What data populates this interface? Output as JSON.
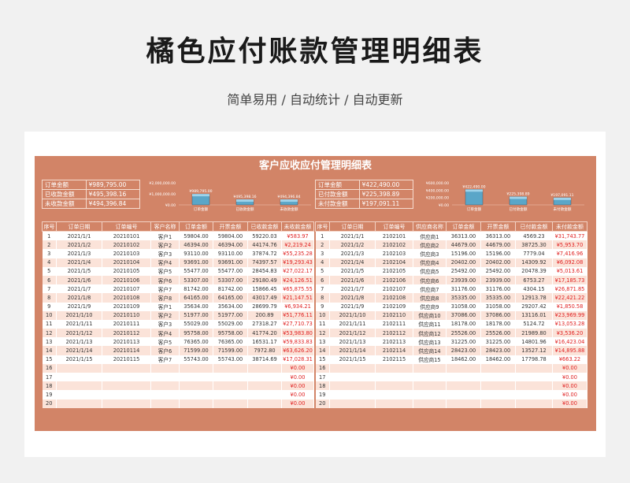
{
  "header": {
    "title": "橘色应付账款管理明细表",
    "subtitle": "简单易用 / 自动统计 / 自动更新"
  },
  "sheet": {
    "title": "客户应收应付管理明细表"
  },
  "receivable": {
    "summary": [
      {
        "label": "订单金额",
        "value": "¥989,795.00"
      },
      {
        "label": "已收款金额",
        "value": "¥495,398.16"
      },
      {
        "label": "未收款金额",
        "value": "¥494,396.84"
      }
    ],
    "chart": {
      "type": "bar",
      "categories": [
        "订单金额",
        "已收款金额",
        "未收款金额"
      ],
      "values": [
        989795.0,
        495398.16,
        494396.84
      ],
      "value_labels": [
        "¥989,795.00",
        "¥495,398.16",
        "¥494,396.84"
      ],
      "yticks": [
        "¥2,000,000.00",
        "¥1,000,000.00",
        "¥0.00"
      ],
      "ylim": [
        0,
        2000000
      ],
      "bar_color": "#5aa6c8"
    },
    "columns": [
      "序号",
      "订单日期",
      "订单编号",
      "客户名称",
      "订单金额",
      "开票金额",
      "已收款金额",
      "未收款金额"
    ],
    "rows": [
      [
        "1",
        "2021/1/1",
        "20210101",
        "客户1",
        "59804.00",
        "59804.00",
        "59220.03",
        "¥583.97"
      ],
      [
        "2",
        "2021/1/2",
        "20210102",
        "客户2",
        "46394.00",
        "46394.00",
        "44174.76",
        "¥2,219.24"
      ],
      [
        "3",
        "2021/1/3",
        "20210103",
        "客户3",
        "93110.00",
        "93110.00",
        "37874.72",
        "¥55,235.28"
      ],
      [
        "4",
        "2021/1/4",
        "20210104",
        "客户4",
        "93691.00",
        "93691.00",
        "74397.57",
        "¥19,293.43"
      ],
      [
        "5",
        "2021/1/5",
        "20210105",
        "客户5",
        "55477.00",
        "55477.00",
        "28454.83",
        "¥27,022.17"
      ],
      [
        "6",
        "2021/1/6",
        "20210106",
        "客户6",
        "53307.00",
        "53307.00",
        "29180.49",
        "¥24,126.51"
      ],
      [
        "7",
        "2021/1/7",
        "20210107",
        "客户7",
        "81742.00",
        "81742.00",
        "15866.45",
        "¥65,875.55"
      ],
      [
        "8",
        "2021/1/8",
        "20210108",
        "客户8",
        "64165.00",
        "64165.00",
        "43017.49",
        "¥21,147.51"
      ],
      [
        "9",
        "2021/1/9",
        "20210109",
        "客户1",
        "35634.00",
        "35634.00",
        "28699.79",
        "¥6,934.21"
      ],
      [
        "10",
        "2021/1/10",
        "20210110",
        "客户2",
        "51977.00",
        "51977.00",
        "200.89",
        "¥51,776.11"
      ],
      [
        "11",
        "2021/1/11",
        "20210111",
        "客户3",
        "55029.00",
        "55029.00",
        "27318.27",
        "¥27,710.73"
      ],
      [
        "12",
        "2021/1/12",
        "20210112",
        "客户4",
        "95758.00",
        "95758.00",
        "41774.20",
        "¥53,983.80"
      ],
      [
        "13",
        "2021/1/13",
        "20210113",
        "客户5",
        "76365.00",
        "76365.00",
        "16531.17",
        "¥59,833.83"
      ],
      [
        "14",
        "2021/1/14",
        "20210114",
        "客户6",
        "71599.00",
        "71599.00",
        "7972.80",
        "¥63,626.20"
      ],
      [
        "15",
        "2021/1/15",
        "20210115",
        "客户7",
        "55743.00",
        "55743.00",
        "38714.69",
        "¥17,028.31"
      ],
      [
        "16",
        "",
        "",
        "",
        "",
        "",
        "",
        "¥0.00"
      ],
      [
        "17",
        "",
        "",
        "",
        "",
        "",
        "",
        "¥0.00"
      ],
      [
        "18",
        "",
        "",
        "",
        "",
        "",
        "",
        "¥0.00"
      ],
      [
        "19",
        "",
        "",
        "",
        "",
        "",
        "",
        "¥0.00"
      ],
      [
        "20",
        "",
        "",
        "",
        "",
        "",
        "",
        "¥0.00"
      ]
    ]
  },
  "payable": {
    "summary": [
      {
        "label": "订单金额",
        "value": "¥422,490.00"
      },
      {
        "label": "已付款金额",
        "value": "¥225,398.89"
      },
      {
        "label": "未付款金额",
        "value": "¥197,091.11"
      }
    ],
    "chart": {
      "type": "bar",
      "categories": [
        "订单金额",
        "已付款金额",
        "未付款金额"
      ],
      "values": [
        422490.0,
        225398.89,
        197091.11
      ],
      "value_labels": [
        "¥422,490.00",
        "¥225,398.89",
        "¥197,091.11"
      ],
      "yticks": [
        "¥600,000.00",
        "¥400,000.00",
        "¥200,000.00",
        "¥0.00"
      ],
      "ylim": [
        0,
        600000
      ],
      "bar_color": "#5aa6c8"
    },
    "columns": [
      "序号",
      "订单日期",
      "订单编号",
      "供应商名称",
      "订单金额",
      "开票金额",
      "已付款金额",
      "未付款金额"
    ],
    "rows": [
      [
        "1",
        "2021/1/1",
        "2102101",
        "供应商1",
        "36313.00",
        "36313.00",
        "4569.23",
        "¥31,743.77"
      ],
      [
        "2",
        "2021/1/2",
        "2102102",
        "供应商2",
        "44679.00",
        "44679.00",
        "38725.30",
        "¥5,953.70"
      ],
      [
        "3",
        "2021/1/3",
        "2102103",
        "供应商3",
        "15196.00",
        "15196.00",
        "7779.04",
        "¥7,416.96"
      ],
      [
        "4",
        "2021/1/4",
        "2102104",
        "供应商4",
        "20402.00",
        "20402.00",
        "14309.92",
        "¥6,092.08"
      ],
      [
        "5",
        "2021/1/5",
        "2102105",
        "供应商5",
        "25492.00",
        "25492.00",
        "20478.39",
        "¥5,013.61"
      ],
      [
        "6",
        "2021/1/6",
        "2102106",
        "供应商6",
        "23939.00",
        "23939.00",
        "6753.27",
        "¥17,185.73"
      ],
      [
        "7",
        "2021/1/7",
        "2102107",
        "供应商7",
        "31176.00",
        "31176.00",
        "4304.15",
        "¥26,871.85"
      ],
      [
        "8",
        "2021/1/8",
        "2102108",
        "供应商8",
        "35335.00",
        "35335.00",
        "12913.78",
        "¥22,421.22"
      ],
      [
        "9",
        "2021/1/9",
        "2102109",
        "供应商9",
        "31058.00",
        "31058.00",
        "29207.42",
        "¥1,850.58"
      ],
      [
        "10",
        "2021/1/10",
        "2102110",
        "供应商10",
        "37086.00",
        "37086.00",
        "13116.01",
        "¥23,969.99"
      ],
      [
        "11",
        "2021/1/11",
        "2102111",
        "供应商11",
        "18178.00",
        "18178.00",
        "5124.72",
        "¥13,053.28"
      ],
      [
        "12",
        "2021/1/12",
        "2102112",
        "供应商12",
        "25526.00",
        "25526.00",
        "21989.80",
        "¥3,536.20"
      ],
      [
        "13",
        "2021/1/13",
        "2102113",
        "供应商13",
        "31225.00",
        "31225.00",
        "14801.96",
        "¥16,423.04"
      ],
      [
        "14",
        "2021/1/14",
        "2102114",
        "供应商14",
        "28423.00",
        "28423.00",
        "13527.12",
        "¥14,895.88"
      ],
      [
        "15",
        "2021/1/15",
        "2102115",
        "供应商15",
        "18462.00",
        "18462.00",
        "17798.78",
        "¥663.22"
      ],
      [
        "16",
        "",
        "",
        "",
        "",
        "",
        "",
        "¥0.00"
      ],
      [
        "17",
        "",
        "",
        "",
        "",
        "",
        "",
        "¥0.00"
      ],
      [
        "18",
        "",
        "",
        "",
        "",
        "",
        "",
        "¥0.00"
      ],
      [
        "19",
        "",
        "",
        "",
        "",
        "",
        "",
        "¥0.00"
      ],
      [
        "20",
        "",
        "",
        "",
        "",
        "",
        "",
        "¥0.00"
      ]
    ]
  }
}
